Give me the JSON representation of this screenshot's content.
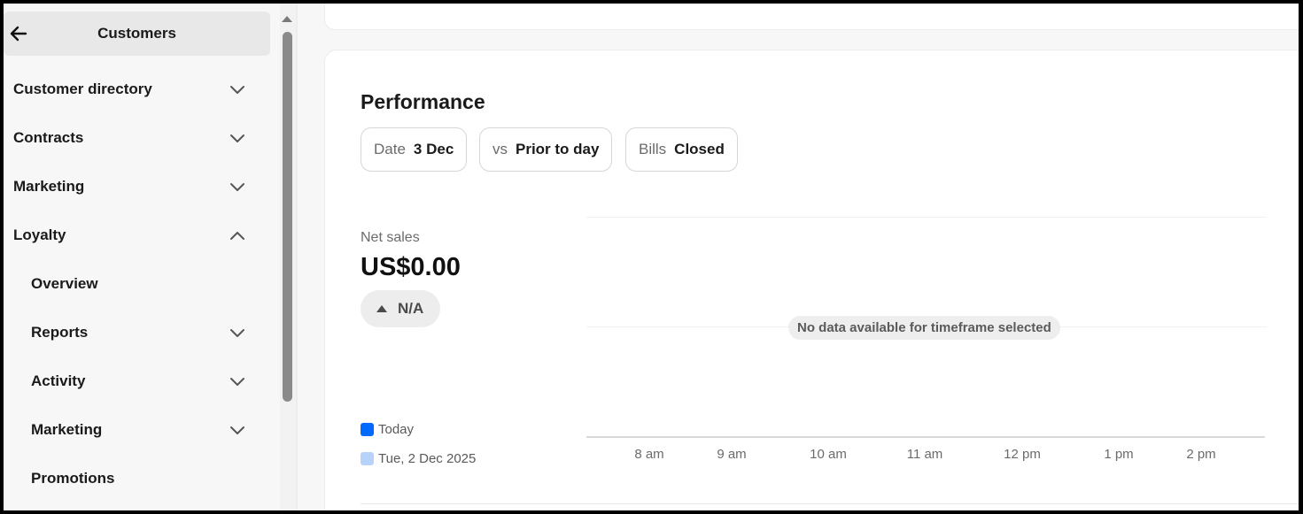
{
  "sidebar": {
    "title": "Customers",
    "items": [
      {
        "label": "Customer directory",
        "level": 0,
        "chevron": "down"
      },
      {
        "label": "Contracts",
        "level": 0,
        "chevron": "down"
      },
      {
        "label": "Marketing",
        "level": 0,
        "chevron": "down"
      },
      {
        "label": "Loyalty",
        "level": 0,
        "chevron": "up"
      },
      {
        "label": "Overview",
        "level": 1,
        "chevron": "none"
      },
      {
        "label": "Reports",
        "level": 1,
        "chevron": "down"
      },
      {
        "label": "Activity",
        "level": 1,
        "chevron": "down"
      },
      {
        "label": "Marketing",
        "level": 1,
        "chevron": "down"
      },
      {
        "label": "Promotions",
        "level": 1,
        "chevron": "none"
      }
    ]
  },
  "performance": {
    "title": "Performance",
    "filters": [
      {
        "key": "Date",
        "value": "3 Dec"
      },
      {
        "key": "vs",
        "value": "Prior to day"
      },
      {
        "key": "Bills",
        "value": "Closed"
      }
    ],
    "metric": {
      "label": "Net sales",
      "value": "US$0.00",
      "change": "N/A"
    },
    "legend": [
      {
        "label": "Today",
        "color": "#006aff"
      },
      {
        "label": "Tue, 2 Dec 2025",
        "color": "#b8d3fb"
      }
    ],
    "no_data_message": "No data available for timeframe selected",
    "x_ticks": [
      "8 am",
      "9 am",
      "10 am",
      "11 am",
      "12 pm",
      "1 pm",
      "2 pm"
    ]
  }
}
